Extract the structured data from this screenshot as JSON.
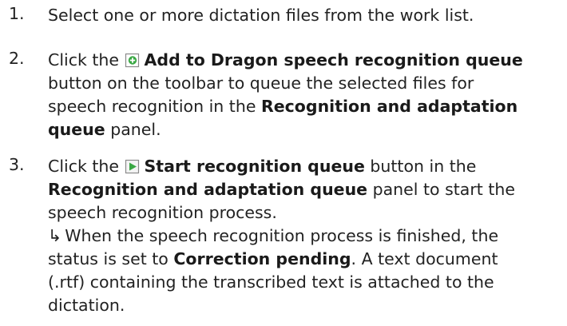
{
  "steps": [
    {
      "number": "1.",
      "text": "Select one or more dictation files from the work list."
    },
    {
      "number": "2.",
      "pre": "Click the",
      "icon": "add-to-queue-icon",
      "button_label": "Add to Dragon speech recognition queue",
      "line2": "button on the toolbar to queue the selected files for",
      "line3": "speech recognition in the",
      "panel_name_part1": "Recognition and adaptation",
      "panel_name_part2": "queue",
      "line4_rest": "panel."
    },
    {
      "number": "3.",
      "pre": "Click the",
      "icon": "play-icon",
      "button_label": "Start recognition queue",
      "line1_rest": "button in the",
      "panel_name": "Recognition and adaptation queue",
      "line2_rest": "panel to start the",
      "line3": "speech recognition process.",
      "result_arrow": "↳",
      "result_line1": "When the speech recognition process is finished, the",
      "result_line2_pre": "status is set to",
      "result_status": "Correction pending",
      "result_line2_post": ". A text document",
      "result_line3": "(.rtf) containing the transcribed text is attached to the",
      "result_line4": "dictation."
    }
  ],
  "colors": {
    "text": "#222222",
    "icon_green": "#3aa844",
    "icon_frame": "#8a8a8a"
  }
}
